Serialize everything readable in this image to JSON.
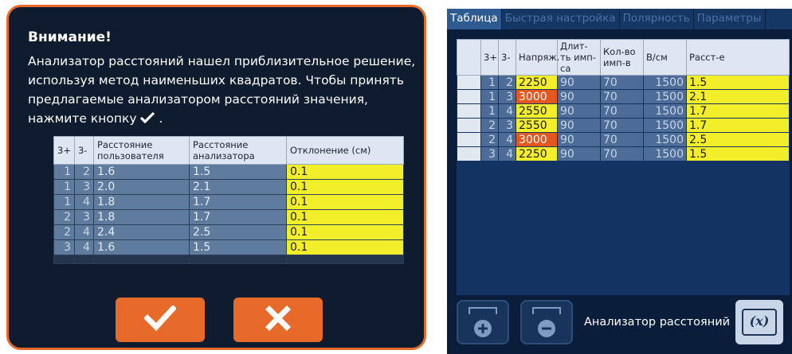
{
  "dialog": {
    "title": "Внимание!",
    "message": "Анализатор расстояний нашел приблизительное решение, используя метод наименьших квадратов. Чтобы принять предлагаемые анализатором расстояний значения, нажмите кнопку",
    "message_end": ".",
    "table": {
      "headers": [
        "3+",
        "3-",
        "Расстояние пользователя",
        "Расстояние анализатора",
        "Отклонение (см)"
      ],
      "rows": [
        [
          "1",
          "2",
          "1.6",
          "1.5",
          "0.1"
        ],
        [
          "1",
          "3",
          "2.0",
          "2.1",
          "0.1"
        ],
        [
          "1",
          "4",
          "1.8",
          "1.7",
          "0.1"
        ],
        [
          "2",
          "3",
          "1.8",
          "1.7",
          "0.1"
        ],
        [
          "2",
          "4",
          "2.4",
          "2.5",
          "0.1"
        ],
        [
          "3",
          "4",
          "1.6",
          "1.5",
          "0.1"
        ]
      ]
    },
    "ok_icon": "checkmark-icon",
    "cancel_icon": "close-icon"
  },
  "right": {
    "tabs": [
      "Таблица",
      "Быстрая настройка",
      "Полярность",
      "Параметры"
    ],
    "active_tab": "Таблица",
    "table": {
      "headers": [
        "",
        "3+",
        "3-",
        "Напряж.",
        "Длит-ть имп-са",
        "Кол-во имп-в",
        "В/см",
        "Расст-е"
      ],
      "rows": [
        [
          "1",
          "2",
          "2250",
          "90",
          "70",
          "1500",
          "1.5"
        ],
        [
          "1",
          "3",
          "3000",
          "90",
          "70",
          "1500",
          "2.1"
        ],
        [
          "1",
          "4",
          "2550",
          "90",
          "70",
          "1500",
          "1.7"
        ],
        [
          "2",
          "3",
          "2550",
          "90",
          "70",
          "1500",
          "1.7"
        ],
        [
          "2",
          "4",
          "3000",
          "90",
          "70",
          "1500",
          "2.5"
        ],
        [
          "3",
          "4",
          "2250",
          "90",
          "70",
          "1500",
          "1.5"
        ]
      ],
      "voltage_highlight": [
        "yellow",
        "orange",
        "yellow",
        "yellow",
        "orange",
        "yellow"
      ]
    },
    "add_button_icon": "add-electrode-icon",
    "remove_button_icon": "remove-electrode-icon",
    "analyzer_label": "Анализатор расстояний",
    "fx_button_label": "(x)"
  },
  "colors": {
    "accent_orange": "#e86a2a",
    "highlight_yellow": "#f3ee2a",
    "highlight_orange": "#e4571f",
    "dialog_bg": "#0f1b2e",
    "panel_bg": "#0a1d3a"
  }
}
